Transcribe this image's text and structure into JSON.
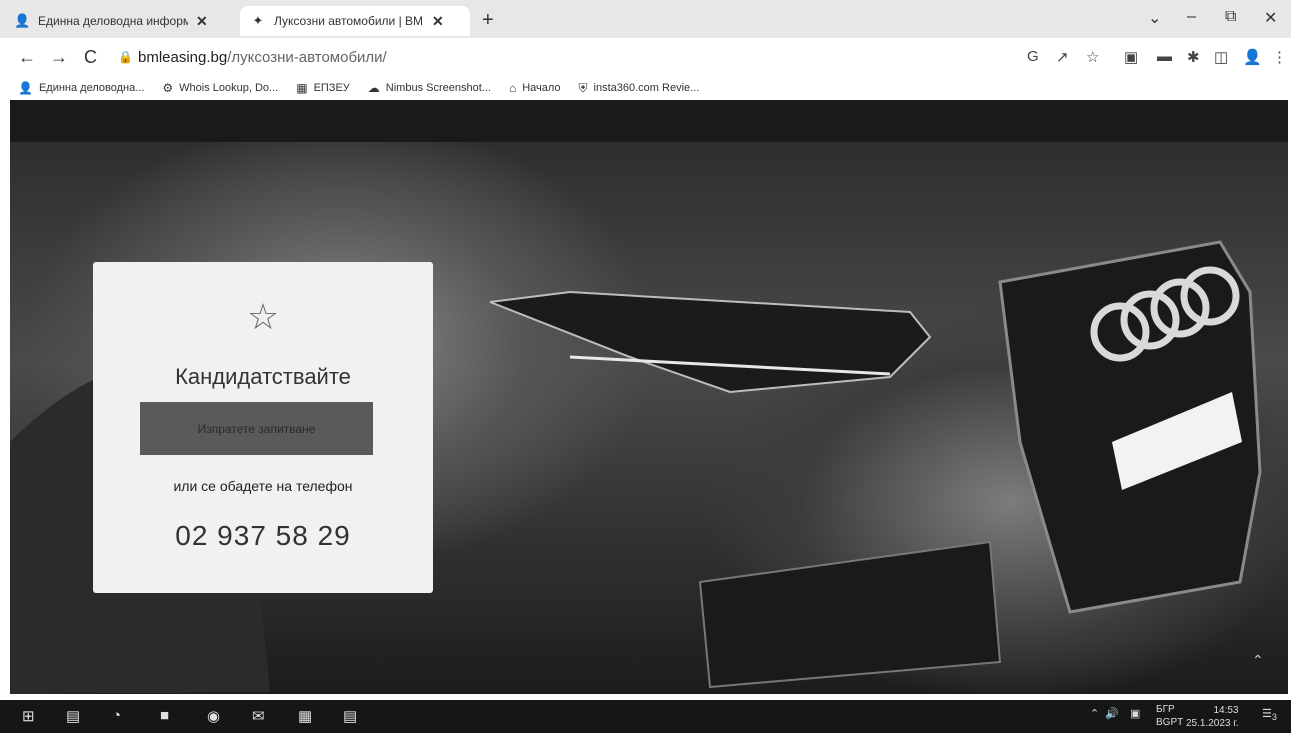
{
  "browser": {
    "tabs": [
      {
        "title": "Единна деловодна информаци",
        "close": "✕"
      },
      {
        "title": "Луксозни автомобили | BM Le",
        "close": "✕"
      }
    ],
    "new_tab": "+",
    "window_controls": [
      "⌄",
      "–",
      "⧉",
      "✕"
    ],
    "nav": {
      "back": "←",
      "forward": "→",
      "reload": "C"
    },
    "url_host": "bmleasing.bg",
    "url_path": "/луксозни-автомобили/",
    "bookmarks": [
      {
        "label": "Единна деловодна...",
        "icon": "person-icon"
      },
      {
        "label": "Whois Lookup, Do...",
        "icon": "gear-icon"
      },
      {
        "label": "ЕПЗЕУ",
        "icon": "folder-icon"
      },
      {
        "label": "Nimbus Screenshot...",
        "icon": "nimbus-icon"
      },
      {
        "label": "Начало",
        "icon": "home-icon"
      },
      {
        "label": "insta360.com Revie...",
        "icon": "shield-icon"
      }
    ]
  },
  "card": {
    "heading": "Кандидатствайте",
    "cta_label": "Изпратете запитване",
    "alt_text": "или се обадете на телефон",
    "phone": "02 937 58 29"
  },
  "taskbar": {
    "lang": "БГР",
    "lang2": "BGPT",
    "time": "14:53",
    "date": "25.1.2023 г.",
    "notifications": "3"
  }
}
